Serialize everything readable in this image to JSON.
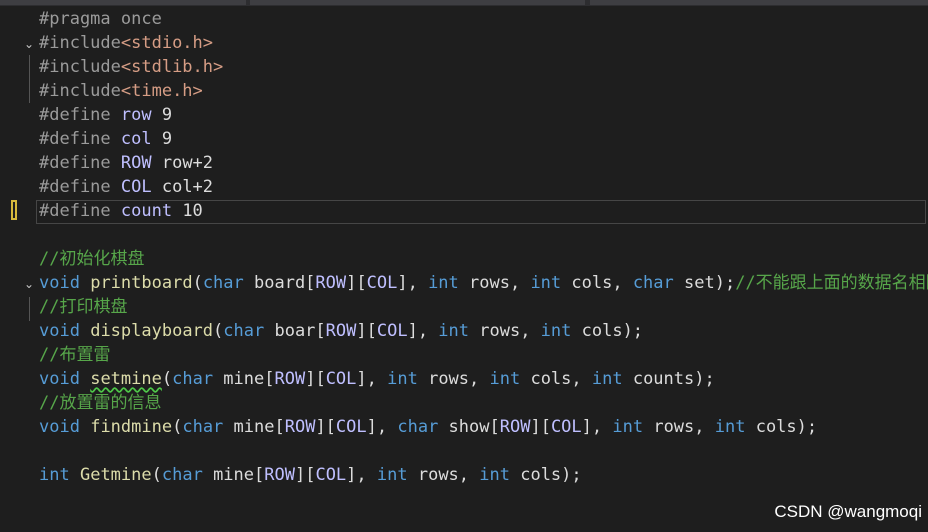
{
  "lines": {
    "l1": {
      "a": "#pragma once"
    },
    "l2": {
      "a": "#include",
      "b": "<stdio.h>"
    },
    "l3": {
      "a": "#include",
      "b": "<stdlib.h>"
    },
    "l4": {
      "a": "#include",
      "b": "<time.h>"
    },
    "l5": {
      "a": "#define ",
      "b": "row",
      "c": " 9"
    },
    "l6": {
      "a": "#define ",
      "b": "col",
      "c": " 9"
    },
    "l7": {
      "a": "#define ",
      "b": "ROW",
      "c": " row+2"
    },
    "l8": {
      "a": "#define ",
      "b": "COL",
      "c": " col+2"
    },
    "l9": {
      "a": "#define ",
      "b": "count",
      "c": " 10"
    },
    "l11": {
      "a": "//初始化棋盘"
    },
    "l12": {
      "t1": "void",
      "t2": " ",
      "t3": "printboard",
      "t4": "(",
      "t5": "char",
      "t6": " board[",
      "t7": "ROW",
      "t8": "][",
      "t9": "COL",
      "t10": "], ",
      "t11": "int",
      "t12": " rows, ",
      "t13": "int",
      "t14": " cols, ",
      "t15": "char",
      "t16": " set);",
      "t17": "//不能跟上面的数据名相同"
    },
    "l13": {
      "a": "//打印棋盘"
    },
    "l14": {
      "t1": "void",
      "t2": " ",
      "t3": "displayboard",
      "t4": "(",
      "t5": "char",
      "t6": " boar[",
      "t7": "ROW",
      "t8": "][",
      "t9": "COL",
      "t10": "], ",
      "t11": "int",
      "t12": " rows, ",
      "t13": "int",
      "t14": " cols);"
    },
    "l15": {
      "a": "//布置雷"
    },
    "l16": {
      "t1": "void",
      "t2": " ",
      "t3": "setmine",
      "t4": "(",
      "t5": "char",
      "t6": " mine[",
      "t7": "ROW",
      "t8": "][",
      "t9": "COL",
      "t10": "], ",
      "t11": "int",
      "t12": " rows, ",
      "t13": "int",
      "t14": " cols, ",
      "t15": "int",
      "t16": " counts);"
    },
    "l17": {
      "a": "//放置雷的信息"
    },
    "l18": {
      "t1": "void",
      "t2": " ",
      "t3": "findmine",
      "t4": "(",
      "t5": "char",
      "t6": " mine[",
      "t7": "ROW",
      "t8": "][",
      "t9": "COL",
      "t10": "], ",
      "t11": "char",
      "t12": " show[",
      "t13": "ROW",
      "t14": "][",
      "t15": "COL",
      "t16": "], ",
      "t17": "int",
      "t18": " rows, ",
      "t19": "int",
      "t20": " cols);"
    },
    "l20": {
      "t1": "int",
      "t2": " ",
      "t3": "Getmine",
      "t4": "(",
      "t5": "char",
      "t6": " mine[",
      "t7": "ROW",
      "t8": "][",
      "t9": "COL",
      "t10": "], ",
      "t11": "int",
      "t12": " rows, ",
      "t13": "int",
      "t14": " cols);"
    }
  },
  "gutter": {
    "fold_glyph": "⌄"
  },
  "colors": {
    "background": "#1e1e1e",
    "keyword": "#569cd6",
    "function": "#dcdcaa",
    "include_string": "#d69d85",
    "macro": "#bfbfff",
    "comment": "#57a64a",
    "number": "#b5cea8",
    "change_marker": "#d7ba3c"
  },
  "watermark": "CSDN @wangmoqi"
}
